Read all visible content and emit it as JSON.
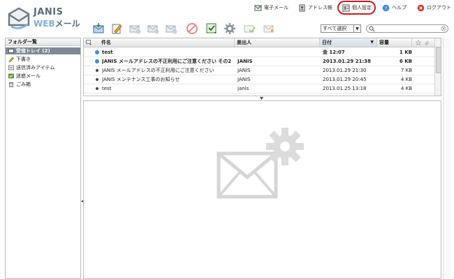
{
  "brand": {
    "name": "JANIS",
    "sub_web": "WEB",
    "sub_mail": "メール"
  },
  "nav": [
    {
      "id": "email",
      "label": "電子メール"
    },
    {
      "id": "address",
      "label": "アドレス帳"
    },
    {
      "id": "settings",
      "label": "個人設定"
    },
    {
      "id": "help",
      "label": "ヘルプ"
    },
    {
      "id": "logout",
      "label": "ログアウト"
    }
  ],
  "filter": {
    "selected": "すべて選択",
    "arrow": "▼"
  },
  "folders": {
    "title": "フォルダ一覧",
    "items": [
      {
        "label": "受信トレイ (2)",
        "icon": "inbox-icon",
        "selected": true
      },
      {
        "label": "下書き",
        "icon": "pencil-icon",
        "selected": false
      },
      {
        "label": "送信済みアイテム",
        "icon": "sent-icon",
        "selected": false
      },
      {
        "label": "迷惑メール",
        "icon": "spam-icon",
        "selected": false
      },
      {
        "label": "ごみ箱",
        "icon": "trash-icon",
        "selected": false
      }
    ]
  },
  "list": {
    "columns": {
      "subject": "件名",
      "from": "差出人",
      "date": "日付",
      "size": "容量"
    },
    "rows": [
      {
        "subject": "test",
        "from": "",
        "date": "金 12:07",
        "size": "1 KB",
        "unread": true
      },
      {
        "subject": "JANIS メールアドレスの不正利用にご注意ください その2",
        "from": "JANIS",
        "date": "2013.01.29 21:38",
        "size": "6 KB",
        "unread": true
      },
      {
        "subject": "JANIS メールアドレスの不正利用にご注意ください",
        "from": "JANIS",
        "date": "2013.01.29 21:30",
        "size": "7 KB",
        "unread": false
      },
      {
        "subject": "JANIS メンテナンス工事のお知らせ",
        "from": "JANIS",
        "date": "2013.01.29 20:45",
        "size": "4 KB",
        "unread": false
      },
      {
        "subject": "test",
        "from": "janis",
        "date": "2013.01.25 13:18",
        "size": "4 KB",
        "unread": false
      }
    ]
  },
  "colors": {
    "accent_ring": "#cc1c1c",
    "selected_folder": "#7f8a95",
    "unread_dot": "#3b8fe0"
  }
}
